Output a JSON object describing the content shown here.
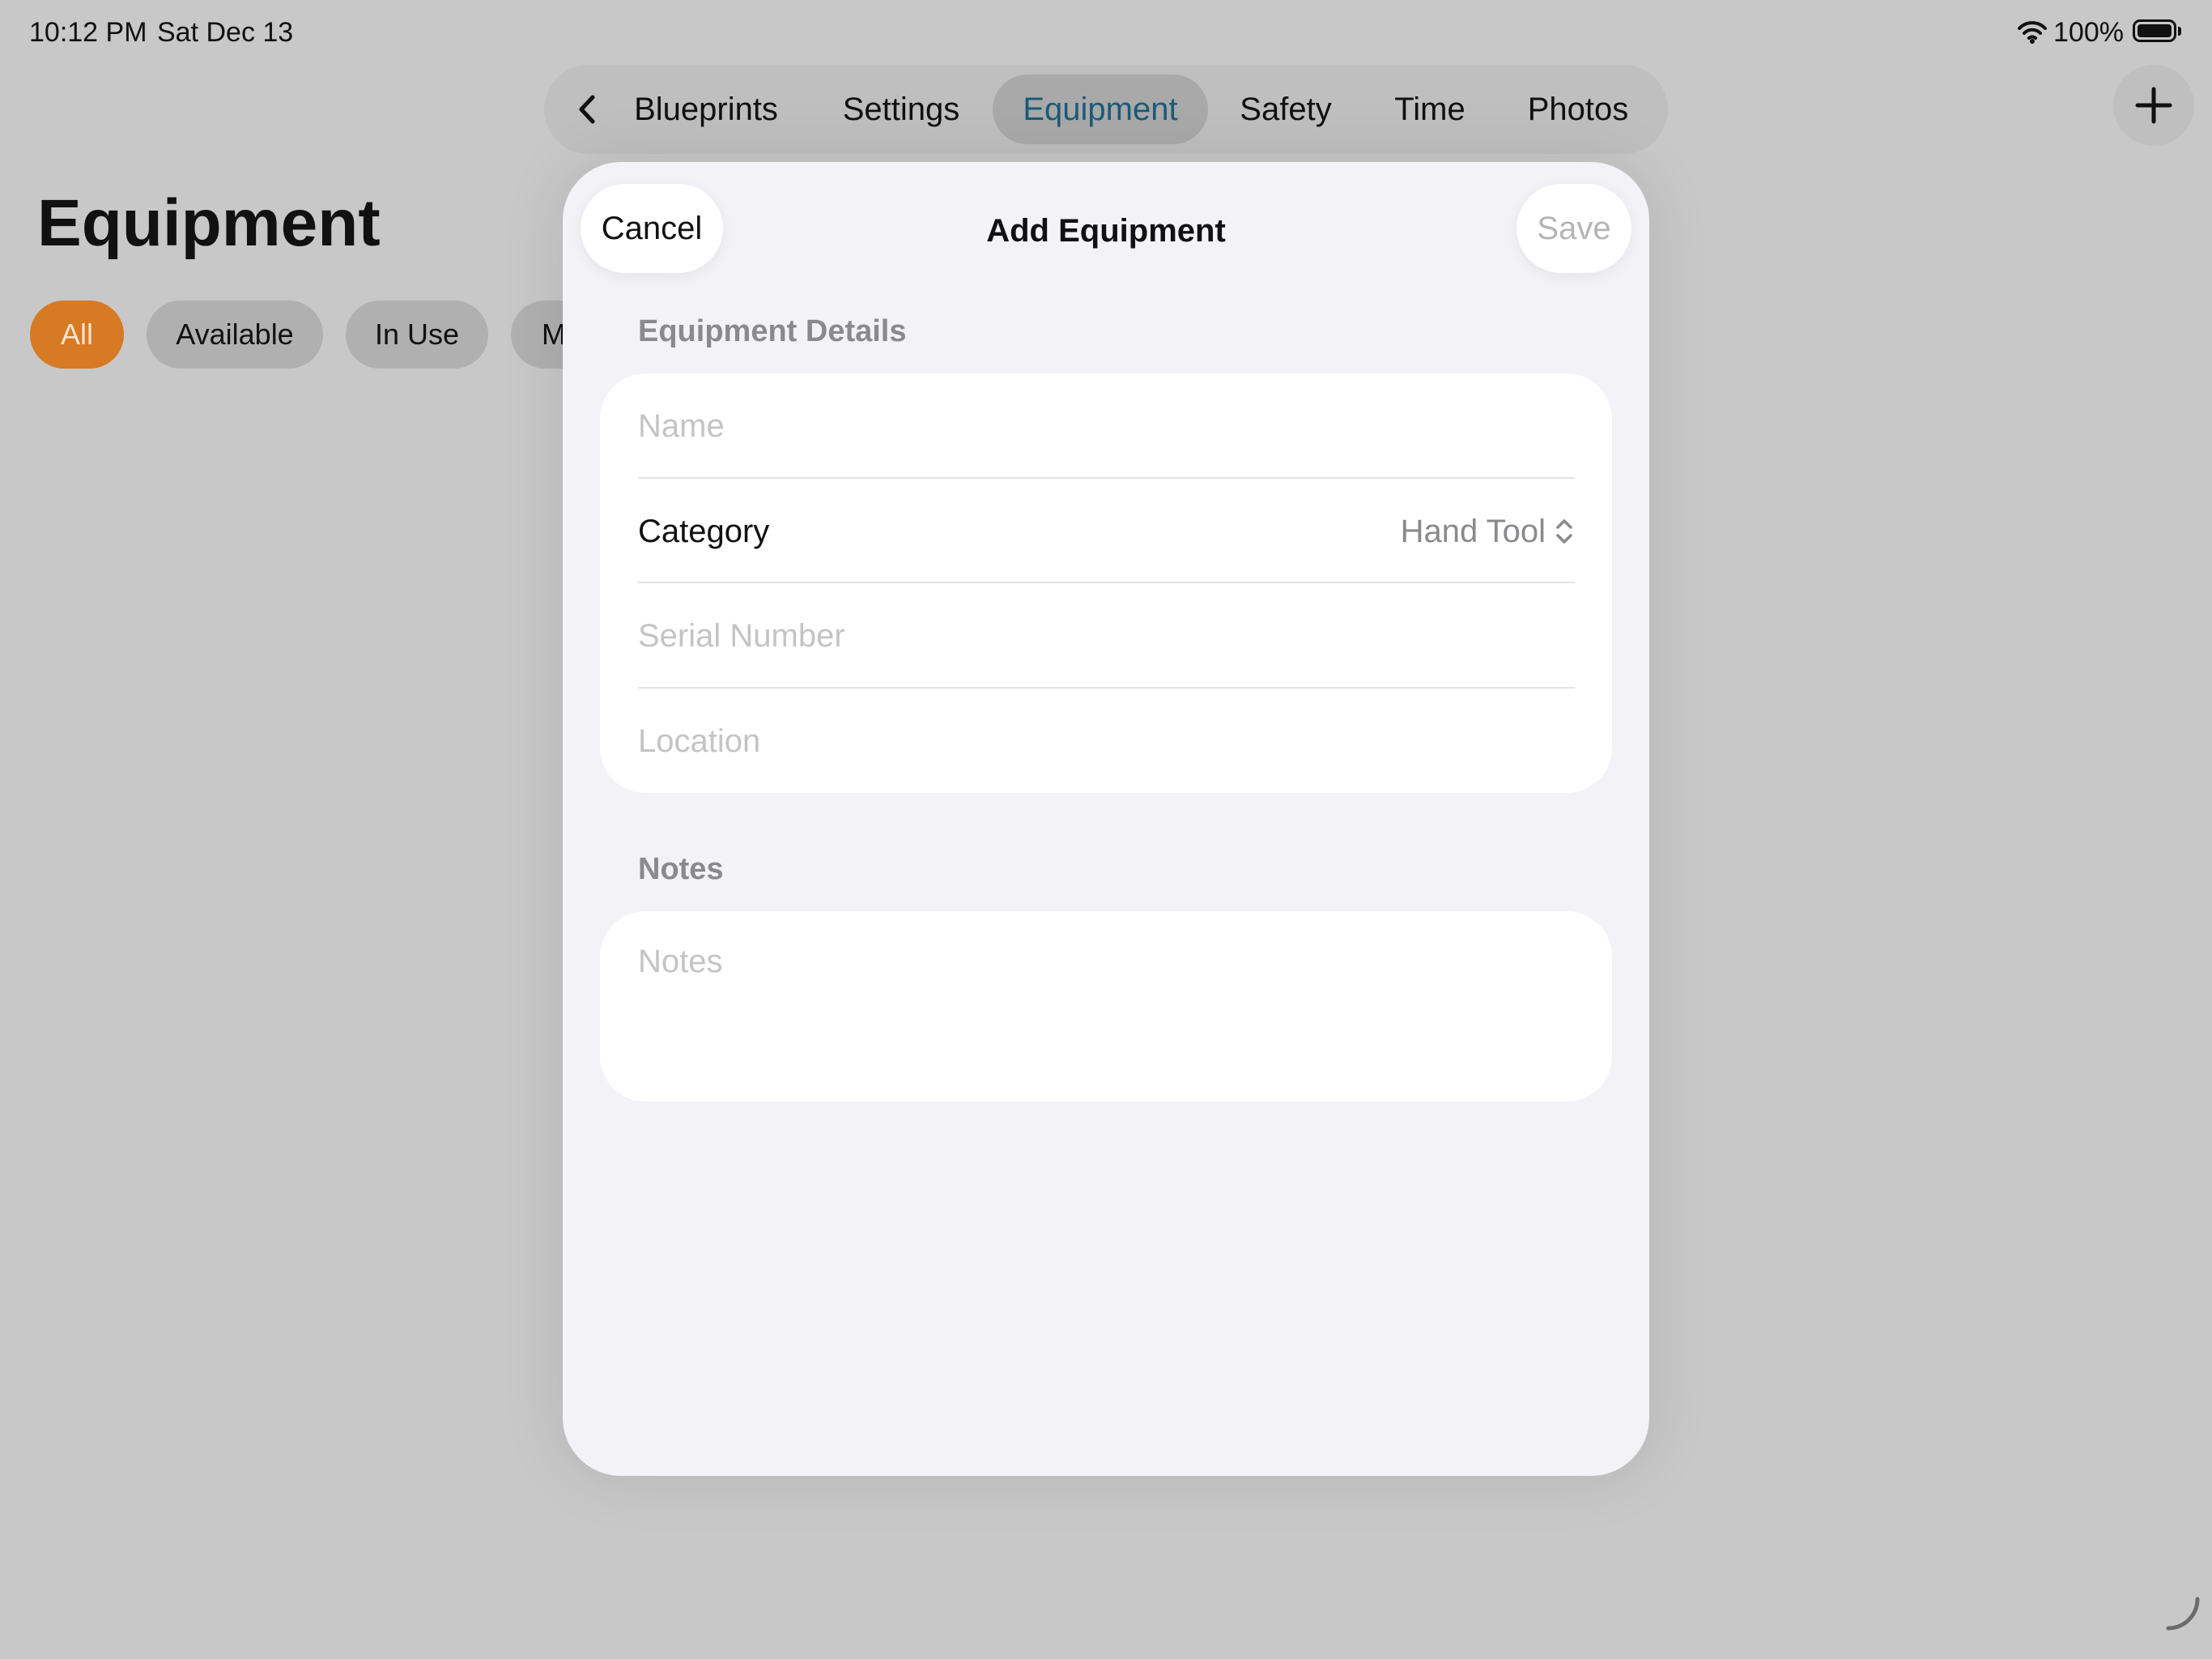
{
  "status_bar": {
    "time": "10:12 PM",
    "date": "Sat Dec 13",
    "battery": "100%",
    "icons": [
      "wifi-icon",
      "battery-icon"
    ]
  },
  "nav": {
    "tabs": [
      {
        "label": "Blueprints",
        "active": false
      },
      {
        "label": "Settings",
        "active": false
      },
      {
        "label": "Equipment",
        "active": true
      },
      {
        "label": "Safety",
        "active": false
      },
      {
        "label": "Time",
        "active": false
      },
      {
        "label": "Photos",
        "active": false
      }
    ],
    "icons": [
      "chevron-left-icon",
      "plus-icon"
    ]
  },
  "background": {
    "title": "Equipment",
    "filters": [
      {
        "label": "All",
        "active": true
      },
      {
        "label": "Available",
        "active": false
      },
      {
        "label": "In Use",
        "active": false
      },
      {
        "label": "M",
        "active": false
      }
    ]
  },
  "sheet": {
    "cancel_label": "Cancel",
    "title": "Add Equipment",
    "save_label": "Save",
    "details_header": "Equipment Details",
    "name_placeholder": "Name",
    "category_label": "Category",
    "category_value": "Hand Tool",
    "serial_placeholder": "Serial Number",
    "location_placeholder": "Location",
    "notes_header": "Notes",
    "notes_placeholder": "Notes"
  },
  "colors": {
    "accent_orange": "#d67a24",
    "active_tab_text": "#1b5b78",
    "sheet_background": "#f2f2f7"
  }
}
